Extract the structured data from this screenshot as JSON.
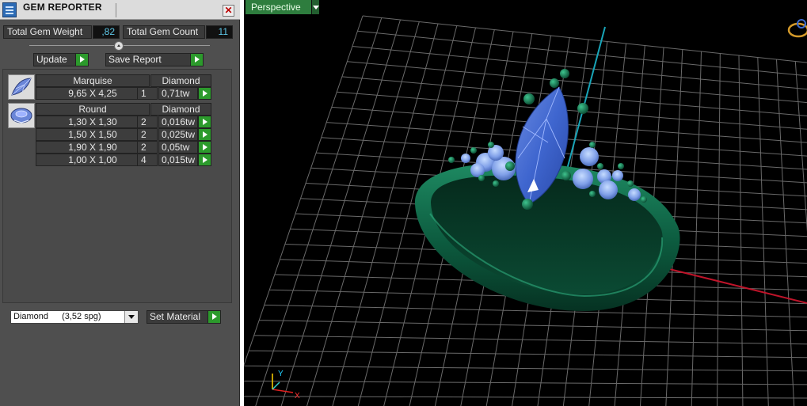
{
  "window": {
    "title": "GEM REPORTER",
    "close_glyph": "✕"
  },
  "summary": {
    "total_weight_label": "Total Gem Weight",
    "total_weight_value": ",82",
    "total_count_label": "Total Gem Count",
    "total_count_value": "11"
  },
  "buttons": {
    "update": "Update",
    "save_report": "Save Report",
    "set_material": "Set Material"
  },
  "gem_groups": [
    {
      "shape": "Marquise",
      "material": "Diamond",
      "icon": "marquise-gem-icon",
      "rows": [
        {
          "size": "9,65 X 4,25",
          "count": "1",
          "weight": "0,71tw"
        }
      ]
    },
    {
      "shape": "Round",
      "material": "Diamond",
      "icon": "round-gem-icon",
      "rows": [
        {
          "size": "1,30 X 1,30",
          "count": "2",
          "weight": "0,016tw"
        },
        {
          "size": "1,50 X 1,50",
          "count": "2",
          "weight": "0,025tw"
        },
        {
          "size": "1,90 X 1,90",
          "count": "2",
          "weight": "0,05tw"
        },
        {
          "size": "1,00 X 1,00",
          "count": "4",
          "weight": "0,015tw"
        }
      ]
    }
  ],
  "material_select": {
    "name": "Diamond",
    "density": "(3,52 spg)"
  },
  "viewport": {
    "view_name": "Perspective",
    "axis_y": "Y",
    "axis_x": "X"
  },
  "colors": {
    "panel_bg": "#4f4f4f",
    "accent_green": "#2c9a2c",
    "value_cyan": "#5ec8e8",
    "gem_blue": "#4a78d8",
    "metal_green": "#0f6b4a",
    "grid": "#6a6a6a"
  }
}
